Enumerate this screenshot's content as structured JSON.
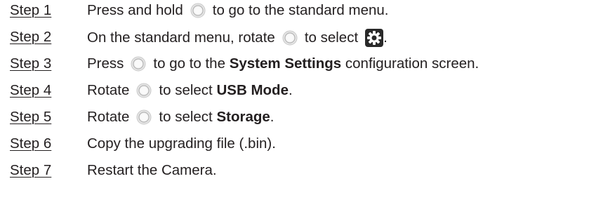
{
  "steps": [
    {
      "label": "Step 1",
      "before": "Press and hold",
      "after": "to go to the standard menu."
    },
    {
      "label": "Step 2",
      "before": "On the standard menu, rotate",
      "middle": "to select",
      "after": "."
    },
    {
      "label": "Step 3",
      "before": "Press",
      "after_a": "to go to the",
      "bold": "System Settings",
      "after_b": "configuration screen."
    },
    {
      "label": "Step 4",
      "before": "Rotate",
      "after_a": "to select",
      "bold": "USB Mode",
      "after_b": "."
    },
    {
      "label": "Step 5",
      "before": "Rotate",
      "after_a": "to select",
      "bold": "Storage",
      "after_b": "."
    },
    {
      "label": "Step 6",
      "text": "Copy the upgrading file (.bin)."
    },
    {
      "label": "Step 7",
      "text": "Restart the Camera."
    }
  ],
  "icons": {
    "dial": "dial-button-icon",
    "gear": "settings-gear-icon"
  }
}
